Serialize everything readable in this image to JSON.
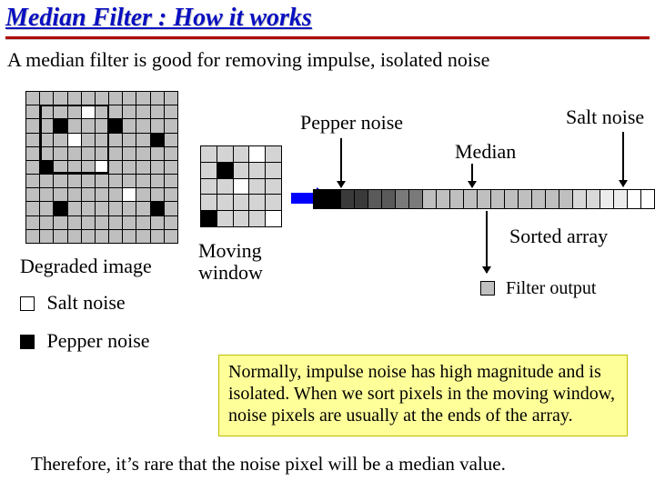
{
  "title": "Median Filter : How it works",
  "intro": "A median filter is good for removing impulse, isolated noise",
  "labels": {
    "pepper_noise": "Pepper noise",
    "salt_noise": "Salt noise",
    "median": "Median",
    "degraded_image": "Degraded image",
    "moving_window": "Moving window",
    "sorted_array": "Sorted array",
    "filter_output": "Filter output"
  },
  "legend": {
    "salt": "Salt noise",
    "pepper": "Pepper noise"
  },
  "note": "Normally, impulse noise has high magnitude and is isolated. When we sort pixels in the moving window,  noise pixels are usually at the ends of the array.",
  "conclusion": "Therefore, it’s rare that the noise pixel will be a median value.",
  "grid11": [
    "g",
    "g",
    "g",
    "g",
    "g",
    "g",
    "g",
    "g",
    "g",
    "g",
    "g",
    "g",
    "g",
    "g",
    "g",
    "w",
    "g",
    "g",
    "g",
    "g",
    "g",
    "g",
    "g",
    "g",
    "b",
    "g",
    "g",
    "g",
    "b",
    "g",
    "g",
    "g",
    "g",
    "g",
    "g",
    "g",
    "w",
    "g",
    "g",
    "g",
    "g",
    "g",
    "b",
    "g",
    "g",
    "g",
    "g",
    "g",
    "g",
    "g",
    "g",
    "g",
    "g",
    "g",
    "g",
    "g",
    "b",
    "g",
    "g",
    "g",
    "w",
    "g",
    "g",
    "g",
    "g",
    "g",
    "g",
    "g",
    "g",
    "g",
    "g",
    "g",
    "g",
    "g",
    "g",
    "g",
    "g",
    "g",
    "g",
    "g",
    "g",
    "g",
    "g",
    "g",
    "w",
    "g",
    "g",
    "g",
    "g",
    "g",
    "b",
    "g",
    "g",
    "g",
    "g",
    "g",
    "g",
    "b",
    "g",
    "g",
    "g",
    "g",
    "g",
    "g",
    "g",
    "g",
    "g",
    "g",
    "g",
    "g",
    "g",
    "g",
    "g",
    "g",
    "g",
    "g",
    "g",
    "g",
    "g",
    "g",
    "g"
  ],
  "grid5": [
    "g",
    "g",
    "g",
    "w",
    "g",
    "g",
    "b",
    "g",
    "g",
    "g",
    "g",
    "g",
    "w",
    "g",
    "g",
    "g",
    "g",
    "g",
    "g",
    "g",
    "b",
    "g",
    "g",
    "g",
    "w"
  ],
  "sorted_array": [
    "b",
    "b",
    "d1",
    "d1",
    "d2",
    "d2",
    "d3",
    "d3",
    "g",
    "g",
    "g",
    "g",
    "g",
    "g",
    "g",
    "g",
    "g",
    "g",
    "g",
    "l1",
    "l1",
    "l2",
    "l2",
    "w",
    "w"
  ],
  "shade_map": {
    "b": "#000000",
    "d1": "#3a3a3a",
    "d2": "#5a5a5a",
    "d3": "#7a7a7a",
    "g": "#bfbfbf",
    "l1": "#d8d8d8",
    "l2": "#ececec",
    "w": "#ffffff"
  }
}
